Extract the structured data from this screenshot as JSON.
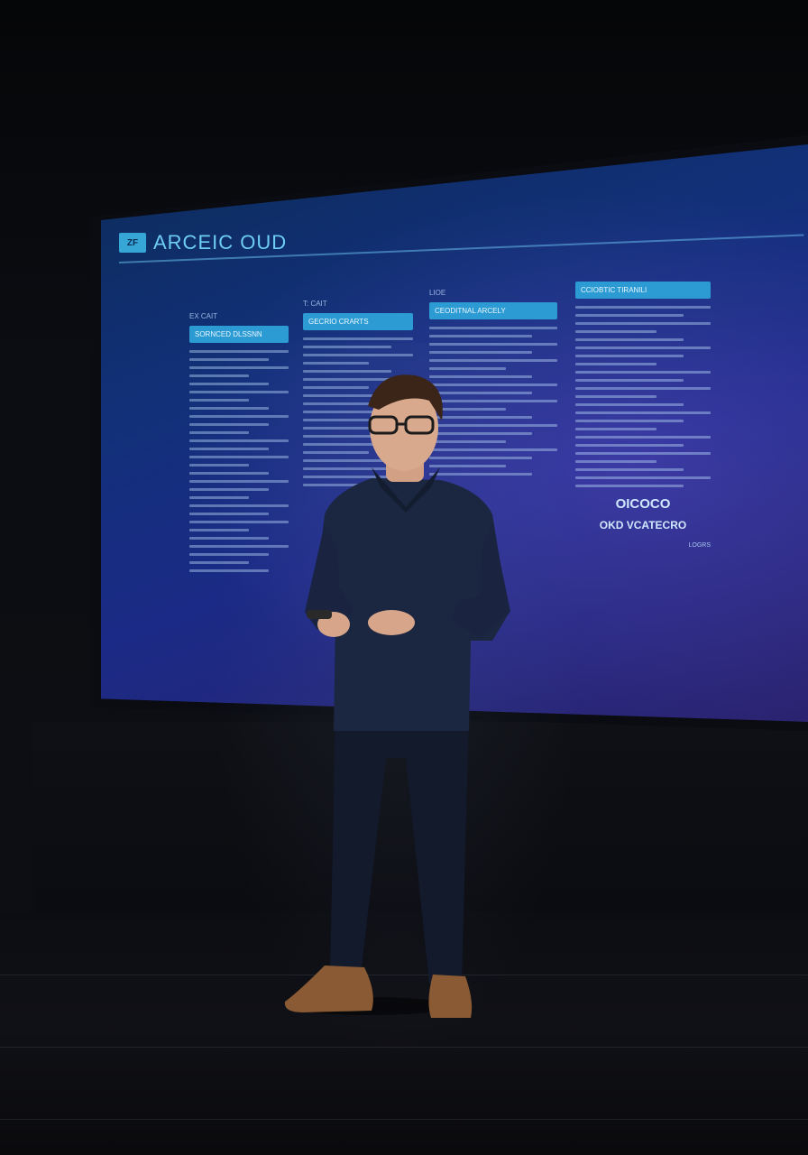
{
  "slide": {
    "logo_mark": "ZF",
    "logo_text": "ARCEIC OUD",
    "columns": [
      {
        "caption": "EX CAIT",
        "header": "SORNCED DLSSNN"
      },
      {
        "caption": "T: CAIT",
        "header": "GECRIO CRARTS"
      },
      {
        "caption": "LIOE",
        "header": "CEODITNAL ARCELY"
      },
      {
        "caption": "",
        "header": "CCIOBTIC TIRANILI"
      }
    ],
    "right_panel": {
      "big_label": "OICOCO",
      "sub_label": "OKD VCATECRO",
      "small_caption": "LOGRS"
    }
  },
  "colors": {
    "screen_top": "#0c2c5a",
    "screen_bottom": "#2b2370",
    "accent": "#2d9bd3",
    "shirt": "#1b2640",
    "shoes": "#8a5a34"
  }
}
